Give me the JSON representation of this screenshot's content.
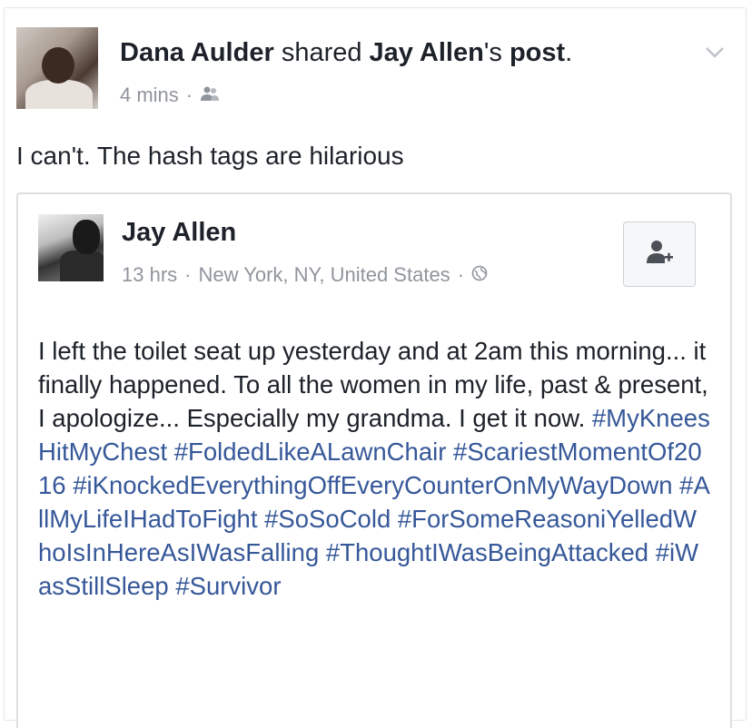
{
  "share": {
    "sharer_name": "Dana Aulder",
    "shared_word": "shared",
    "original_owner": "Jay Allen",
    "possessive": "'s",
    "object": "post",
    "period": ".",
    "time": "4 mins",
    "separator": "·",
    "audience_icon": "friends-icon",
    "menu_icon": "chevron-down-icon",
    "status_text": "I can't. The hash tags are hilarious"
  },
  "original_post": {
    "author": "Jay Allen",
    "time": "13 hrs",
    "separator1": "·",
    "location": "New York, NY, United States",
    "separator2": "·",
    "audience_icon": "globe-icon",
    "add_friend_icon": "add-friend-icon",
    "body_text": "I left the toilet seat up yesterday and at 2am this morning... it finally happened. To all the women in my life, past & present, I apologize... Especially my grandma. I get it now.",
    "hashtags": [
      "#MyKneesHitMyChest",
      "#FoldedLikeALawnChair",
      "#ScariestMomentOf2016",
      "#iKnockedEverythingOffEveryCounterOnMyWayDown",
      "#AllMyLifeIHadToFight",
      "#SoSoCold",
      "#ForSomeReasoniYelledWhoIsInHereAsIWasFalling",
      "#ThoughtIWasBeingAttacked",
      "#iWasStillSleep",
      "#Survivor"
    ]
  },
  "colors": {
    "link": "#365899",
    "meta": "#90949c",
    "text": "#1d2129"
  }
}
